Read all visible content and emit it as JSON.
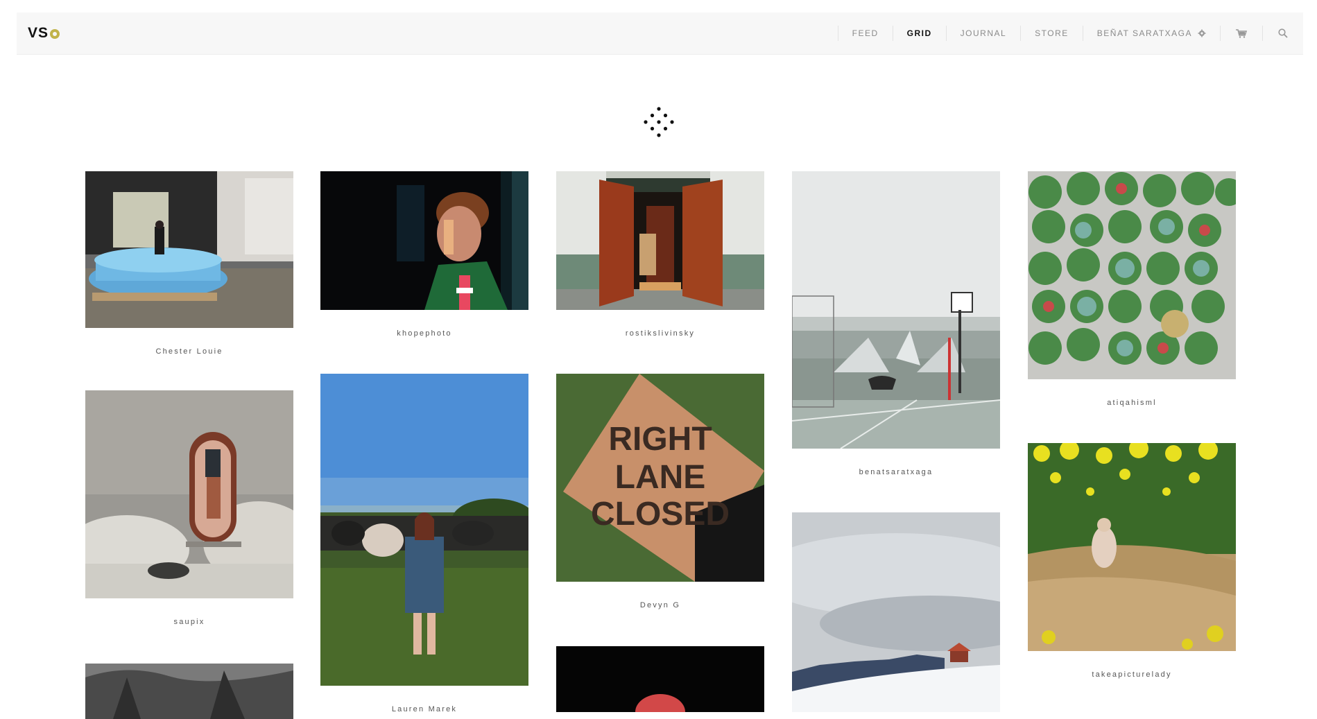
{
  "brand": {
    "logo": "VS"
  },
  "nav": {
    "feed": "FEED",
    "grid": "GRID",
    "journal": "JOURNAL",
    "store": "STORE",
    "user": "BEÑAT SARATXAGA"
  },
  "icons": {
    "settings": "gear-icon",
    "cart": "cart-icon",
    "search": "search-icon",
    "loader": "loading-dots-icon"
  },
  "colors": {
    "accent": "#c1b34a",
    "nav_active": "#111111",
    "nav_inactive": "#8a8a8a"
  },
  "grid": {
    "col1": [
      "Chester Louie",
      "saupix",
      ""
    ],
    "col2": [
      "khopephoto",
      "Lauren Marek"
    ],
    "col3": [
      "rostikslivinsky",
      "Devyn G",
      ""
    ],
    "col4": [
      "benatsaratxaga",
      ""
    ],
    "col5": [
      "atiqahisml",
      "takeapicturelady"
    ]
  }
}
